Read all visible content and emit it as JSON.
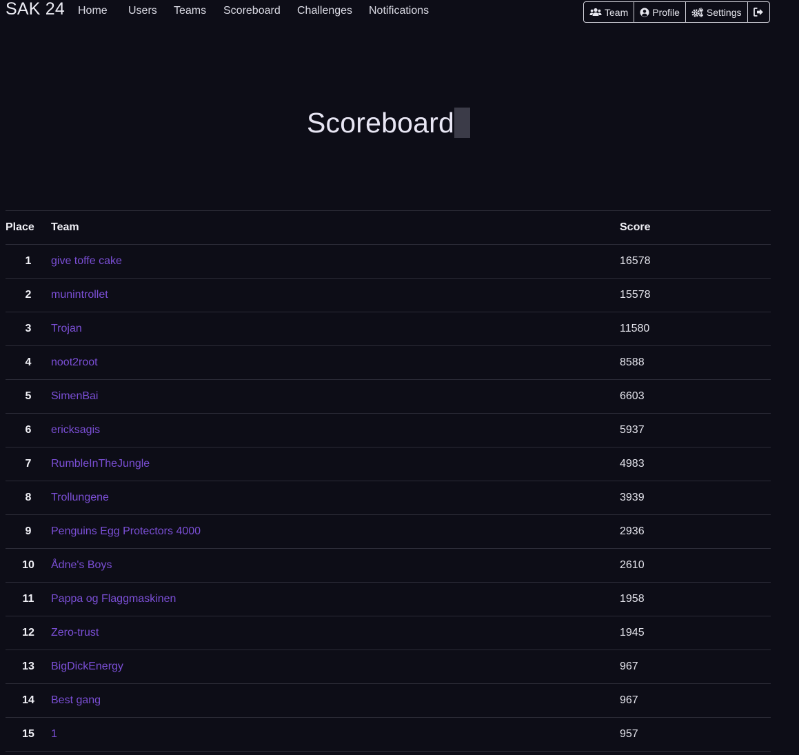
{
  "navbar": {
    "brand": "SAK 24",
    "links": [
      "Home",
      "Users",
      "Teams",
      "Scoreboard",
      "Challenges",
      "Notifications"
    ],
    "buttons": {
      "team": "Team",
      "profile": "Profile",
      "settings": "Settings"
    }
  },
  "page": {
    "title": "Scoreboard"
  },
  "table": {
    "headers": {
      "place": "Place",
      "team": "Team",
      "score": "Score"
    },
    "rows": [
      {
        "place": "1",
        "team": "give toffe cake",
        "score": "16578"
      },
      {
        "place": "2",
        "team": "munintrollet",
        "score": "15578"
      },
      {
        "place": "3",
        "team": "Trojan",
        "score": "11580"
      },
      {
        "place": "4",
        "team": "noot2root",
        "score": "8588"
      },
      {
        "place": "5",
        "team": "SimenBai",
        "score": "6603"
      },
      {
        "place": "6",
        "team": "ericksagis",
        "score": "5937"
      },
      {
        "place": "7",
        "team": "RumbleInTheJungle",
        "score": "4983"
      },
      {
        "place": "8",
        "team": "Trollungene",
        "score": "3939"
      },
      {
        "place": "9",
        "team": "Penguins Egg Protectors 4000",
        "score": "2936"
      },
      {
        "place": "10",
        "team": "Ådne's Boys",
        "score": "2610"
      },
      {
        "place": "11",
        "team": "Pappa og Flaggmaskinen",
        "score": "1958"
      },
      {
        "place": "12",
        "team": "Zero-trust",
        "score": "1945"
      },
      {
        "place": "13",
        "team": "BigDickEnergy",
        "score": "967"
      },
      {
        "place": "14",
        "team": "Best gang",
        "score": "967"
      },
      {
        "place": "15",
        "team": "1",
        "score": "957"
      }
    ]
  },
  "icons": {
    "team": "users-icon",
    "profile": "user-circle-icon",
    "settings": "cogs-icon",
    "logout": "sign-out-icon"
  },
  "colors": {
    "background": "#0d0d17",
    "link": "#7b4fd6",
    "text": "#e6e6ee"
  }
}
